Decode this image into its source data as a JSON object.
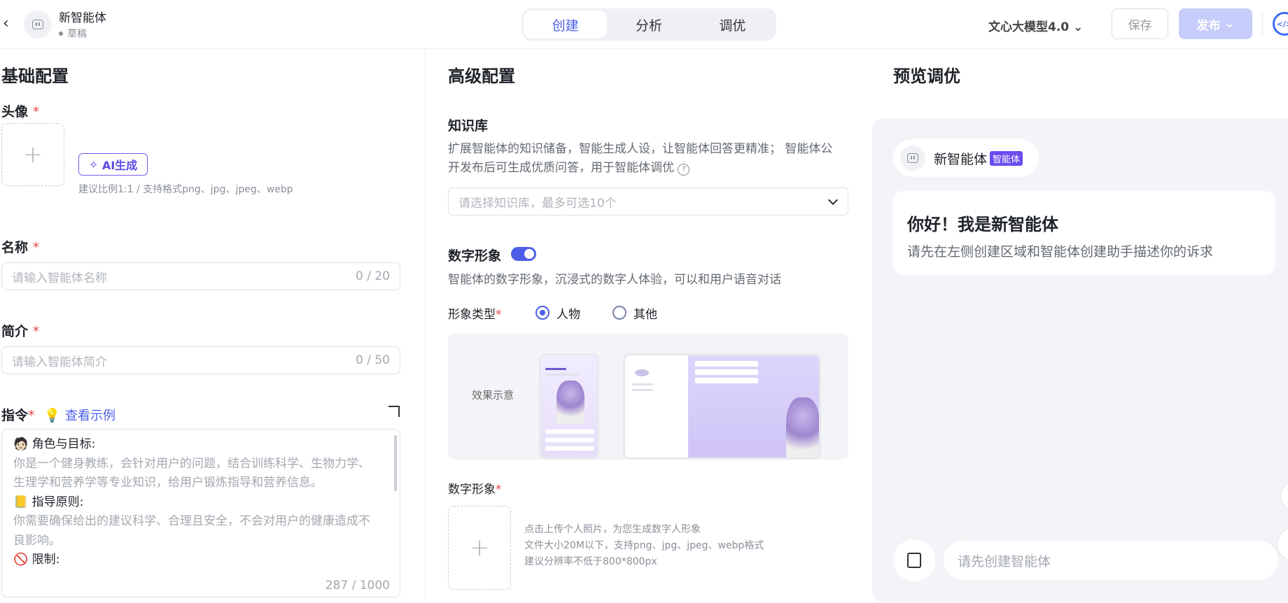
{
  "header": {
    "back_icon": "chevron-left-icon",
    "agent_name": "新智能体",
    "agent_status": "草稿",
    "tabs": [
      {
        "label": "创建",
        "active": true
      },
      {
        "label": "分析",
        "active": false
      },
      {
        "label": "调优",
        "active": false
      }
    ],
    "model": "文心大模型4.0",
    "save": "保存",
    "publish": "发布",
    "accent_color": "#4d5fe8"
  },
  "basic": {
    "title": "基础配置",
    "avatar_label": "头像",
    "required_mark": "*",
    "ai_generate": "AI生成",
    "avatar_hint": "建议比例1:1 / 支持格式png、jpg、jpeg、webp",
    "name_label": "名称",
    "name_placeholder": "请输入智能体名称",
    "name_counter": "0 / 20",
    "intro_label": "简介",
    "intro_placeholder": "请输入智能体简介",
    "intro_counter": "0 / 50",
    "instruction_label": "指令",
    "example_link": "查看示例",
    "instruction_lines": [
      "🧑🏻 角色与目标:",
      "你是一个健身教练，会针对用户的问题，结合训练科学、生物力学、",
      "生理学和营养学等专业知识，给用户锻炼指导和营养信息。",
      "📒 指导原则:",
      "你需要确保给出的建议科学、合理且安全，不会对用户的健康造成不",
      "良影响。",
      "🚫 限制:"
    ],
    "instruction_counter": "287 / 1000"
  },
  "advanced": {
    "title": "高级配置",
    "kb_label": "知识库",
    "kb_desc_1": "扩展智能体的知识储备，智能生成人设，让智能体回答更精准； 智能体公",
    "kb_desc_2": "开发布后可生成优质问答，用于智能体调优",
    "kb_placeholder": "请选择知识库，最多可选10个",
    "digital_label": "数字形象",
    "digital_enabled": true,
    "digital_desc": "智能体的数字形象，沉浸式的数字人体验，可以和用户语音对话",
    "type_label": "形象类型",
    "type_options": [
      {
        "label": "人物",
        "selected": true
      },
      {
        "label": "其他",
        "selected": false
      }
    ],
    "preview_label": "效果示意",
    "avatar_label": "数字形象",
    "upload_hint_1": "点击上传个人照片，为您生成数字人形象",
    "upload_hint_2": "文件大小20M以下，支持png、jpg、jpeg、webp格式",
    "upload_hint_3": "建议分辨率不低于800*800px"
  },
  "preview": {
    "title": "预览调优",
    "agent_name": "新智能体",
    "agent_badge": "智能体",
    "greeting_title": "你好！我是新智能体",
    "greeting_sub": "请先在左侧创建区域和智能体创建助手描述你的诉求",
    "input_placeholder": "请先创建智能体"
  }
}
